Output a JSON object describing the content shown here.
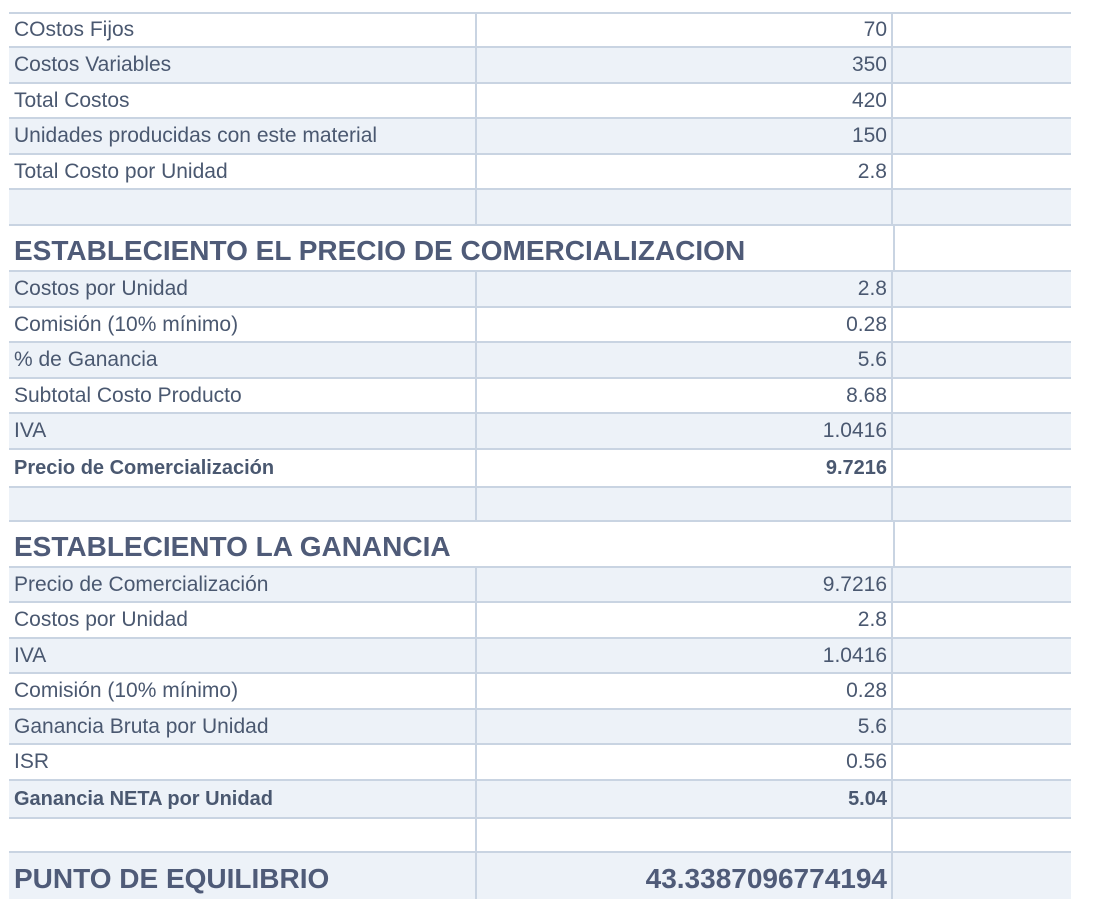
{
  "costs": [
    {
      "label": "COstos Fijos",
      "value": "70"
    },
    {
      "label": "Costos Variables",
      "value": "350"
    },
    {
      "label": "Total Costos",
      "value": "420"
    },
    {
      "label": "Unidades producidas con este material",
      "value": "150"
    },
    {
      "label": "Total Costo por Unidad",
      "value": "2.8"
    }
  ],
  "price_section": {
    "title": "ESTABLECIENTO EL PRECIO DE COMERCIALIZACION",
    "rows": [
      {
        "label": "Costos por Unidad",
        "value": "2.8"
      },
      {
        "label": "Comisión (10% mínimo)",
        "value": "0.28"
      },
      {
        "label": "% de Ganancia",
        "value": "5.6"
      },
      {
        "label": "Subtotal Costo Producto",
        "value": "8.68"
      },
      {
        "label": "IVA",
        "value": "1.0416"
      }
    ],
    "total": {
      "label": "Precio de Comercialización",
      "value": "9.7216"
    }
  },
  "profit_section": {
    "title": "ESTABLECIENTO LA GANANCIA",
    "rows": [
      {
        "label": "Precio de Comercialización",
        "value": "9.7216"
      },
      {
        "label": "Costos por Unidad",
        "value": "2.8"
      },
      {
        "label": "IVA",
        "value": "1.0416"
      },
      {
        "label": "Comisión (10% mínimo)",
        "value": "0.28"
      },
      {
        "label": "Ganancia Bruta por Unidad",
        "value": "5.6"
      },
      {
        "label": "ISR",
        "value": "0.56"
      }
    ],
    "total": {
      "label": "Ganancia NETA por Unidad",
      "value": "5.04"
    }
  },
  "break_even": {
    "label": "PUNTO DE EQUILIBRIO",
    "value": "43.3387096774194"
  }
}
